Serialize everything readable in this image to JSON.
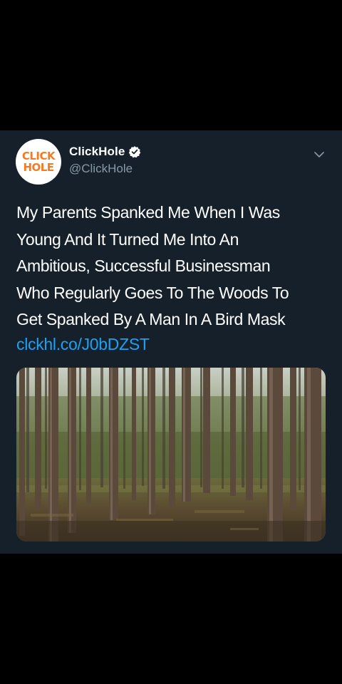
{
  "colors": {
    "page_background": "#000000",
    "tweet_background": "#15202b",
    "text_primary": "#ffffff",
    "text_secondary": "#8899a6",
    "link": "#1da1f2",
    "verified_badge": "#ffffff",
    "logo_orange": "#f47b20"
  },
  "tweet": {
    "avatar": {
      "logo_line_1": "CLICK",
      "logo_line_2": "HOLE"
    },
    "author": {
      "display_name": "ClickHole",
      "handle": "@ClickHole",
      "verified": true
    },
    "menu_icon": "chevron-down-icon",
    "text_lines": [
      "My Parents Spanked Me When I Was",
      "Young And It Turned Me Into An",
      "Ambitious, Successful Businessman",
      "Who Regularly Goes To The Woods To",
      "Get Spanked By A Man In A Bird Mask"
    ],
    "link": "clckhl.co/J0bDZST",
    "media": {
      "type": "photo",
      "icon": "forest-photo"
    }
  }
}
